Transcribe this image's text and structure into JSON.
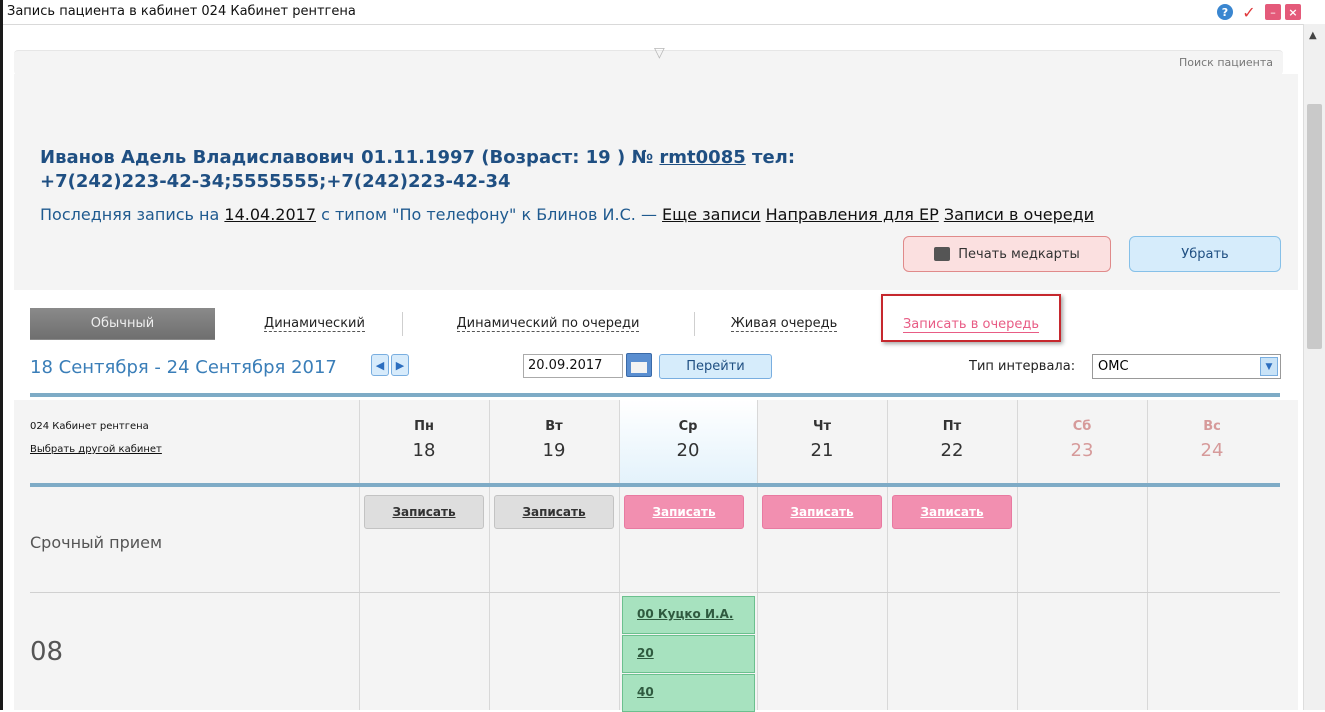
{
  "window": {
    "title": "Запись пациента в кабинет 024 Кабинет рентгена",
    "controls": {
      "help": "?",
      "confirm": "✓",
      "minimize": "–",
      "close": "×"
    }
  },
  "search": {
    "link": "Поиск пациента"
  },
  "patient": {
    "name_line": "Иванов Адель Владиславович 01.11.1997 (Возраст: 19 ) № ",
    "card_no": "rmt0085",
    "tel_label": " тел:",
    "phones": "+7(242)223-42-34;5555555;+7(242)223-42-34",
    "last_record_prefix": "Последняя запись на ",
    "last_record_date": "14.04.2017",
    "last_record_suffix": " с типом \"По телефону\" к Блинов И.С. — ",
    "links": [
      "Еще записи",
      "Направления для ЕР",
      "Записи в очереди"
    ]
  },
  "actions": {
    "print": "Печать медкарты",
    "remove": "Убрать"
  },
  "tabs": [
    "Обычный",
    "Динамический",
    "Динамический по очереди",
    "Живая очередь",
    "Записать в очередь"
  ],
  "period": "18 Сентября - 24 Сентября 2017",
  "date_field": "20.09.2017",
  "go_button": "Перейти",
  "interval": {
    "label": "Тип интервала:",
    "value": "ОМС"
  },
  "cabinet": {
    "name": "024 Кабинет рентгена",
    "change_link": "Выбрать другой кабинет"
  },
  "days": [
    {
      "dow": "Пн",
      "day": "18"
    },
    {
      "dow": "Вт",
      "day": "19"
    },
    {
      "dow": "Ср",
      "day": "20"
    },
    {
      "dow": "Чт",
      "day": "21"
    },
    {
      "dow": "Пт",
      "day": "22"
    },
    {
      "dow": "Сб",
      "day": "23"
    },
    {
      "dow": "Вс",
      "day": "24"
    }
  ],
  "urgent": {
    "label": "Срочный прием",
    "book_label": "Записать"
  },
  "hour_block": {
    "hour": "08",
    "slots": [
      "00 Куцко И.А.",
      "20",
      "40"
    ]
  },
  "colors": {
    "accent_blue": "#3a7eb8",
    "booking_pink": "#f28fb0",
    "slot_green": "#a7e2bf"
  }
}
